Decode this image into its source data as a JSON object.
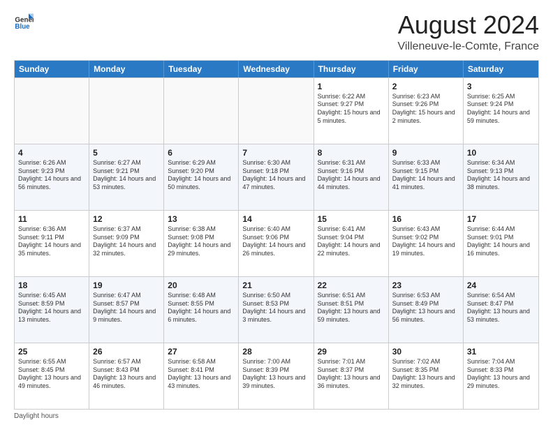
{
  "logo": {
    "line1": "General",
    "line2": "Blue"
  },
  "title": "August 2024",
  "subtitle": "Villeneuve-le-Comte, France",
  "weekdays": [
    "Sunday",
    "Monday",
    "Tuesday",
    "Wednesday",
    "Thursday",
    "Friday",
    "Saturday"
  ],
  "footer": "Daylight hours",
  "weeks": [
    [
      {
        "day": "",
        "info": ""
      },
      {
        "day": "",
        "info": ""
      },
      {
        "day": "",
        "info": ""
      },
      {
        "day": "",
        "info": ""
      },
      {
        "day": "1",
        "info": "Sunrise: 6:22 AM\nSunset: 9:27 PM\nDaylight: 15 hours\nand 5 minutes."
      },
      {
        "day": "2",
        "info": "Sunrise: 6:23 AM\nSunset: 9:26 PM\nDaylight: 15 hours\nand 2 minutes."
      },
      {
        "day": "3",
        "info": "Sunrise: 6:25 AM\nSunset: 9:24 PM\nDaylight: 14 hours\nand 59 minutes."
      }
    ],
    [
      {
        "day": "4",
        "info": "Sunrise: 6:26 AM\nSunset: 9:23 PM\nDaylight: 14 hours\nand 56 minutes."
      },
      {
        "day": "5",
        "info": "Sunrise: 6:27 AM\nSunset: 9:21 PM\nDaylight: 14 hours\nand 53 minutes."
      },
      {
        "day": "6",
        "info": "Sunrise: 6:29 AM\nSunset: 9:20 PM\nDaylight: 14 hours\nand 50 minutes."
      },
      {
        "day": "7",
        "info": "Sunrise: 6:30 AM\nSunset: 9:18 PM\nDaylight: 14 hours\nand 47 minutes."
      },
      {
        "day": "8",
        "info": "Sunrise: 6:31 AM\nSunset: 9:16 PM\nDaylight: 14 hours\nand 44 minutes."
      },
      {
        "day": "9",
        "info": "Sunrise: 6:33 AM\nSunset: 9:15 PM\nDaylight: 14 hours\nand 41 minutes."
      },
      {
        "day": "10",
        "info": "Sunrise: 6:34 AM\nSunset: 9:13 PM\nDaylight: 14 hours\nand 38 minutes."
      }
    ],
    [
      {
        "day": "11",
        "info": "Sunrise: 6:36 AM\nSunset: 9:11 PM\nDaylight: 14 hours\nand 35 minutes."
      },
      {
        "day": "12",
        "info": "Sunrise: 6:37 AM\nSunset: 9:09 PM\nDaylight: 14 hours\nand 32 minutes."
      },
      {
        "day": "13",
        "info": "Sunrise: 6:38 AM\nSunset: 9:08 PM\nDaylight: 14 hours\nand 29 minutes."
      },
      {
        "day": "14",
        "info": "Sunrise: 6:40 AM\nSunset: 9:06 PM\nDaylight: 14 hours\nand 26 minutes."
      },
      {
        "day": "15",
        "info": "Sunrise: 6:41 AM\nSunset: 9:04 PM\nDaylight: 14 hours\nand 22 minutes."
      },
      {
        "day": "16",
        "info": "Sunrise: 6:43 AM\nSunset: 9:02 PM\nDaylight: 14 hours\nand 19 minutes."
      },
      {
        "day": "17",
        "info": "Sunrise: 6:44 AM\nSunset: 9:01 PM\nDaylight: 14 hours\nand 16 minutes."
      }
    ],
    [
      {
        "day": "18",
        "info": "Sunrise: 6:45 AM\nSunset: 8:59 PM\nDaylight: 14 hours\nand 13 minutes."
      },
      {
        "day": "19",
        "info": "Sunrise: 6:47 AM\nSunset: 8:57 PM\nDaylight: 14 hours\nand 9 minutes."
      },
      {
        "day": "20",
        "info": "Sunrise: 6:48 AM\nSunset: 8:55 PM\nDaylight: 14 hours\nand 6 minutes."
      },
      {
        "day": "21",
        "info": "Sunrise: 6:50 AM\nSunset: 8:53 PM\nDaylight: 14 hours\nand 3 minutes."
      },
      {
        "day": "22",
        "info": "Sunrise: 6:51 AM\nSunset: 8:51 PM\nDaylight: 13 hours\nand 59 minutes."
      },
      {
        "day": "23",
        "info": "Sunrise: 6:53 AM\nSunset: 8:49 PM\nDaylight: 13 hours\nand 56 minutes."
      },
      {
        "day": "24",
        "info": "Sunrise: 6:54 AM\nSunset: 8:47 PM\nDaylight: 13 hours\nand 53 minutes."
      }
    ],
    [
      {
        "day": "25",
        "info": "Sunrise: 6:55 AM\nSunset: 8:45 PM\nDaylight: 13 hours\nand 49 minutes."
      },
      {
        "day": "26",
        "info": "Sunrise: 6:57 AM\nSunset: 8:43 PM\nDaylight: 13 hours\nand 46 minutes."
      },
      {
        "day": "27",
        "info": "Sunrise: 6:58 AM\nSunset: 8:41 PM\nDaylight: 13 hours\nand 43 minutes."
      },
      {
        "day": "28",
        "info": "Sunrise: 7:00 AM\nSunset: 8:39 PM\nDaylight: 13 hours\nand 39 minutes."
      },
      {
        "day": "29",
        "info": "Sunrise: 7:01 AM\nSunset: 8:37 PM\nDaylight: 13 hours\nand 36 minutes."
      },
      {
        "day": "30",
        "info": "Sunrise: 7:02 AM\nSunset: 8:35 PM\nDaylight: 13 hours\nand 32 minutes."
      },
      {
        "day": "31",
        "info": "Sunrise: 7:04 AM\nSunset: 8:33 PM\nDaylight: 13 hours\nand 29 minutes."
      }
    ]
  ]
}
